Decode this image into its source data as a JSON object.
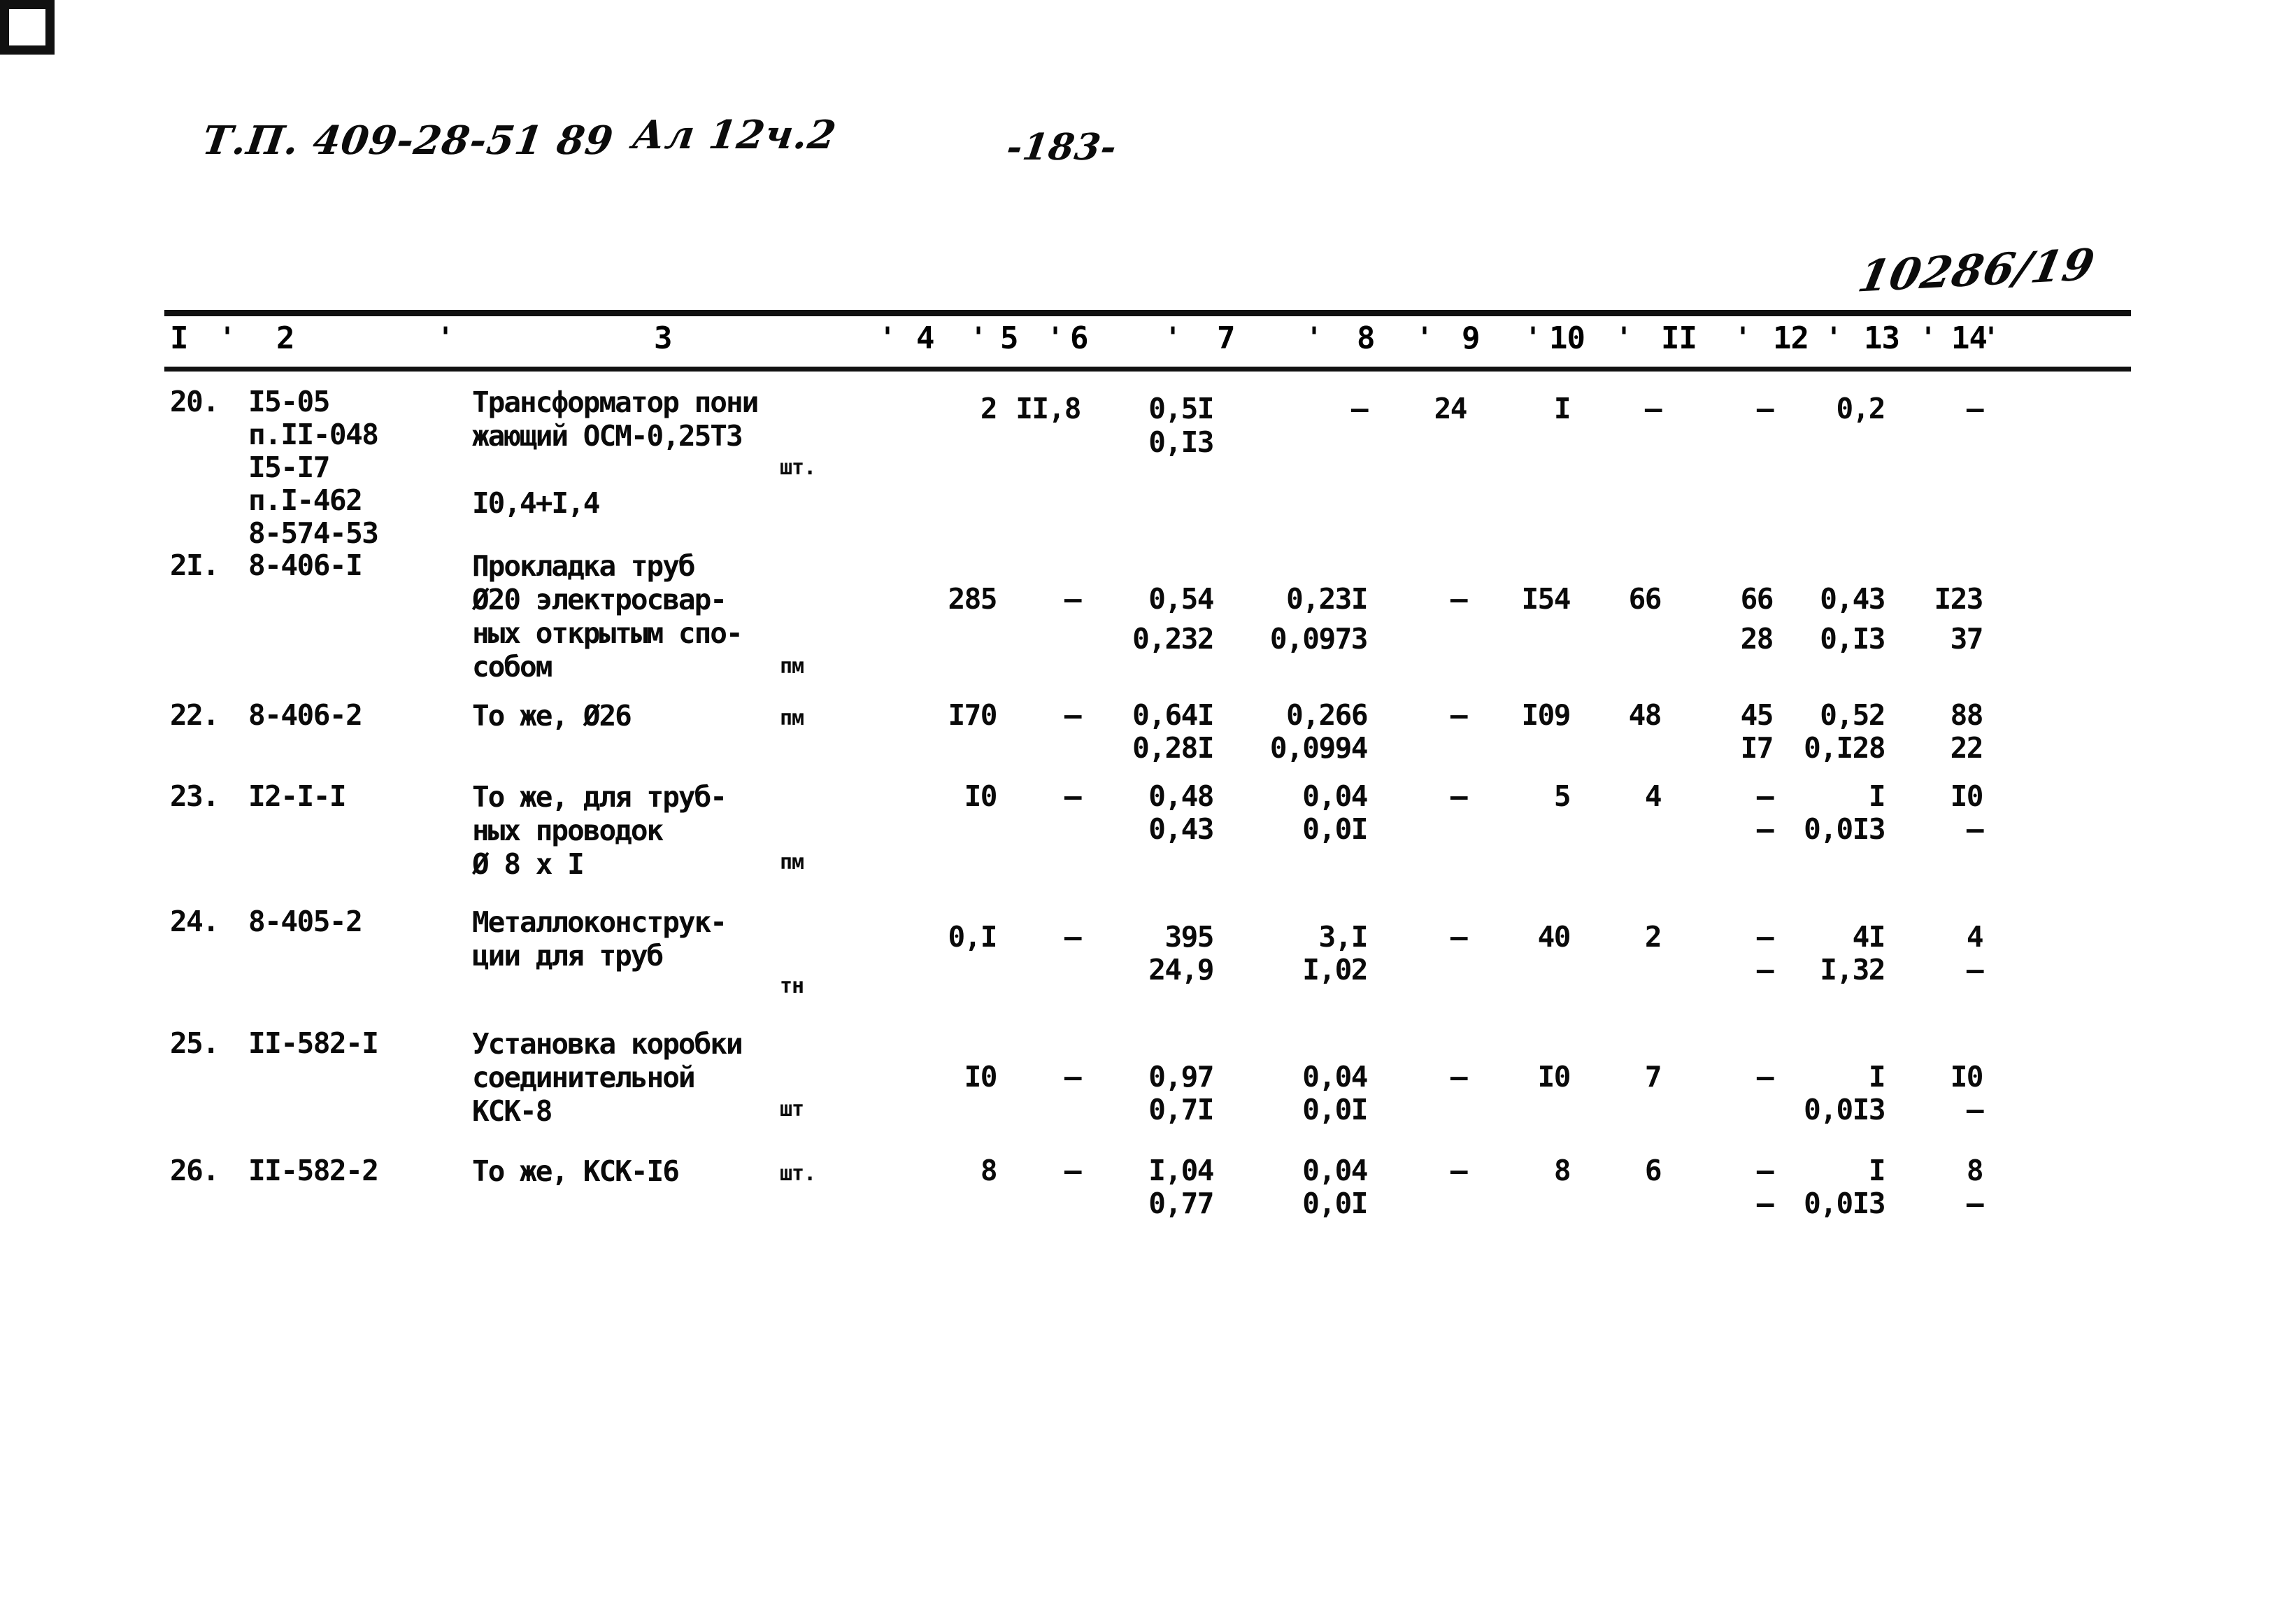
{
  "header": {
    "project_code": "Т.П. 409-28-51 89",
    "album": "Ал 12ч.2",
    "page_number": "-183-",
    "stamp": "10286/19"
  },
  "table": {
    "column_headers": [
      "I",
      "2",
      "3",
      "4",
      "5",
      "6",
      "7",
      "8",
      "9",
      "10",
      "II",
      "12",
      "13",
      "14"
    ],
    "tick": "'",
    "rows": [
      {
        "no": "20.",
        "codes": [
          "I5-05",
          "п.II-048",
          "I5-I7",
          "п.I-462",
          "8-574-53"
        ],
        "desc_lines": [
          "Трансформатор пони",
          "жающий ОСМ-0,25Т3",
          "",
          "I0,4+I,4"
        ],
        "unit": "шт.",
        "c4": "2",
        "c5": "II,8",
        "c6": "0,5I",
        "c6b": "0,I3",
        "c7": "–",
        "c7b": "",
        "c8": "24",
        "c9": "I",
        "c10": "–",
        "c11": "–",
        "c11b": "",
        "c12": "0,2",
        "c12b": "",
        "c13": "–",
        "c13b": ""
      },
      {
        "no": "2I.",
        "codes": [
          "8-406-I"
        ],
        "desc_lines": [
          "Прокладка труб",
          "Ø20 электросвар-",
          "ных открытым спо-",
          "собом"
        ],
        "unit": "пм",
        "c4": "285",
        "c5": "–",
        "c6": "0,54",
        "c6b": "0,232",
        "c7": "0,23I",
        "c7b": "0,0973",
        "c8": "–",
        "c9": "I54",
        "c10": "66",
        "c11": "66",
        "c11b": "28",
        "c12": "0,43",
        "c12b": "0,I3",
        "c13": "I23",
        "c13b": "37"
      },
      {
        "no": "22.",
        "codes": [
          "8-406-2"
        ],
        "desc_lines": [
          "То же, Ø26"
        ],
        "unit": "пм",
        "c4": "I70",
        "c5": "–",
        "c6": "0,64I",
        "c6b": "0,28I",
        "c7": "0,266",
        "c7b": "0,0994",
        "c8": "–",
        "c9": "I09",
        "c10": "48",
        "c11": "45",
        "c11b": "I7",
        "c12": "0,52",
        "c12b": "0,I28",
        "c13": "88",
        "c13b": "22"
      },
      {
        "no": "23.",
        "codes": [
          "I2-I-I"
        ],
        "desc_lines": [
          "То же, для труб-",
          "ных проводок",
          "Ø 8 х I"
        ],
        "unit": "пм",
        "c4": "I0",
        "c5": "–",
        "c6": "0,48",
        "c6b": "0,43",
        "c7": "0,04",
        "c7b": "0,0I",
        "c8": "–",
        "c9": "5",
        "c10": "4",
        "c11": "–",
        "c11b": "–",
        "c12": "I",
        "c12b": "0,0I3",
        "c13": "I0",
        "c13b": "–"
      },
      {
        "no": "24.",
        "codes": [
          "8-405-2"
        ],
        "desc_lines": [
          "Металлоконструк-",
          "ции для труб"
        ],
        "unit": "тн",
        "c4": "0,I",
        "c5": "–",
        "c6": "395",
        "c6b": "24,9",
        "c7": "3,I",
        "c7b": "I,02",
        "c8": "–",
        "c9": "40",
        "c10": "2",
        "c11": "–",
        "c11b": "–",
        "c12": "4I",
        "c12b": "I,32",
        "c13": "4",
        "c13b": "–"
      },
      {
        "no": "25.",
        "codes": [
          "II-582-I"
        ],
        "desc_lines": [
          "Установка коробки",
          "соединительной",
          "КСК-8"
        ],
        "unit": "шт",
        "c4": "I0",
        "c5": "–",
        "c6": "0,97",
        "c6b": "0,7I",
        "c7": "0,04",
        "c7b": "0,0I",
        "c8": "–",
        "c9": "I0",
        "c10": "7",
        "c11": "–",
        "c11b": "",
        "c12": "I",
        "c12b": "0,0I3",
        "c13": "I0",
        "c13b": "–"
      },
      {
        "no": "26.",
        "codes": [
          "II-582-2"
        ],
        "desc_lines": [
          "То же, КСК-I6"
        ],
        "unit": "шт.",
        "c4": "8",
        "c5": "–",
        "c6": "I,04",
        "c6b": "0,77",
        "c7": "0,04",
        "c7b": "0,0I",
        "c8": "–",
        "c9": "8",
        "c10": "6",
        "c11": "–",
        "c11b": "–",
        "c12": "I",
        "c12b": "0,0I3",
        "c13": "8",
        "c13b": "–"
      }
    ]
  }
}
